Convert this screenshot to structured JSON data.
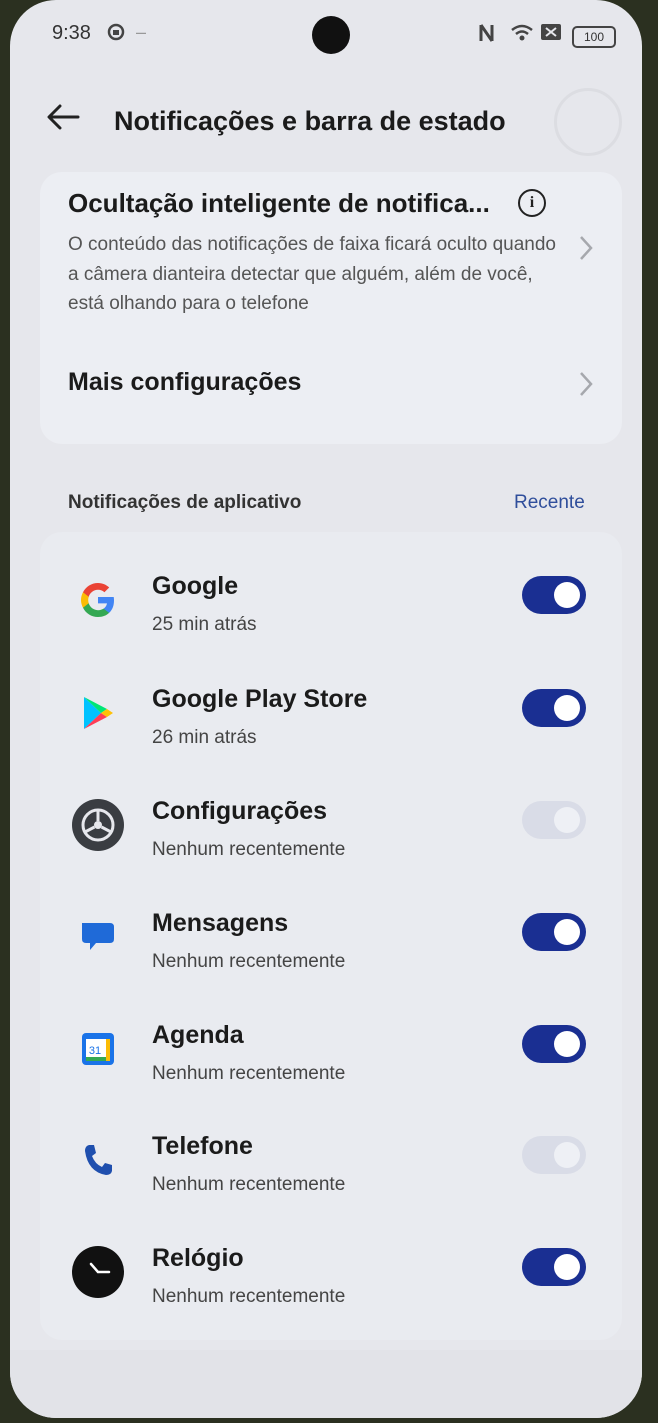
{
  "status_bar": {
    "time": "9:38",
    "battery": "100"
  },
  "header": {
    "title": "Notificações e barra de estado"
  },
  "smart_hide": {
    "title": "Ocultação inteligente de notifica...",
    "description": "O conteúdo das notificações de faixa ficará oculto quando a câmera dianteira detectar que alguém, além de você, está olhando para o telefone"
  },
  "more_settings": {
    "label": "Mais configurações"
  },
  "app_notifications": {
    "heading": "Notificações de aplicativo",
    "sort_label": "Recente",
    "apps": [
      {
        "name": "Google",
        "sub": "25 min atrás",
        "enabled": true,
        "toggle_disabled": false
      },
      {
        "name": "Google Play Store",
        "sub": "26 min atrás",
        "enabled": true,
        "toggle_disabled": false
      },
      {
        "name": "Configurações",
        "sub": "Nenhum recentemente",
        "enabled": true,
        "toggle_disabled": true
      },
      {
        "name": "Mensagens",
        "sub": "Nenhum recentemente",
        "enabled": true,
        "toggle_disabled": false
      },
      {
        "name": "Agenda",
        "sub": "Nenhum recentemente",
        "enabled": true,
        "toggle_disabled": false
      },
      {
        "name": "Telefone",
        "sub": "Nenhum recentemente",
        "enabled": true,
        "toggle_disabled": true
      },
      {
        "name": "Relógio",
        "sub": "Nenhum recentemente",
        "enabled": true,
        "toggle_disabled": false
      }
    ],
    "calendar_day": "31"
  },
  "colors": {
    "accent": "#1a2f92",
    "link": "#2f4e9b"
  }
}
